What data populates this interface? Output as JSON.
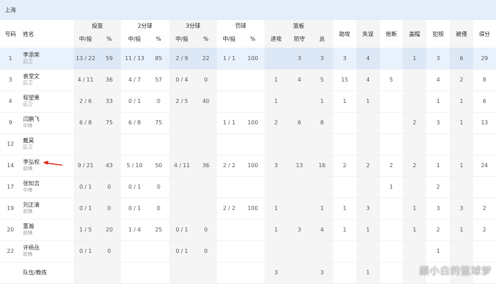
{
  "team": "上海",
  "headers": {
    "number": "号码",
    "name": "姓名",
    "fg": "投篮",
    "two": "2分球",
    "three": "3分球",
    "ft": "罚球",
    "reb": "篮板",
    "made_att": "中/投",
    "pct": "%",
    "oreb": "进攻",
    "dreb": "防守",
    "treb": "总",
    "ast": "助攻",
    "tov": "失误",
    "stl": "抢断",
    "blk": "盖帽",
    "pf": "犯规",
    "fd": "被侵",
    "pts": "得分"
  },
  "rows": [
    {
      "no": "1",
      "name": "李添荣",
      "pos": "后卫",
      "fg": "13 / 22",
      "fgp": "59",
      "two": "11 / 13",
      "twop": "85",
      "three": "2 / 9",
      "threep": "22",
      "ft": "1 / 1",
      "ftp": "100",
      "oreb": "",
      "dreb": "3",
      "treb": "3",
      "ast": "3",
      "tov": "4",
      "stl": "",
      "blk": "1",
      "pf": "3",
      "fd": "6",
      "pts": "29"
    },
    {
      "no": "3",
      "name": "袁堂文",
      "pos": "后卫",
      "fg": "4 / 11",
      "fgp": "36",
      "two": "4 / 7",
      "twop": "57",
      "three": "0 / 4",
      "threep": "0",
      "ft": "",
      "ftp": "",
      "oreb": "1",
      "dreb": "4",
      "treb": "5",
      "ast": "15",
      "tov": "4",
      "stl": "5",
      "blk": "",
      "pf": "4",
      "fd": "2",
      "pts": "8"
    },
    {
      "no": "4",
      "name": "程望果",
      "pos": "后卫",
      "fg": "2 / 6",
      "fgp": "33",
      "two": "0 / 1",
      "twop": "0",
      "three": "2 / 5",
      "threep": "40",
      "ft": "",
      "ftp": "",
      "oreb": "1",
      "dreb": "",
      "treb": "1",
      "ast": "1",
      "tov": "1",
      "stl": "",
      "blk": "",
      "pf": "1",
      "fd": "1",
      "pts": "6"
    },
    {
      "no": "9",
      "name": "闫鹏飞",
      "pos": "中锋",
      "fg": "6 / 8",
      "fgp": "75",
      "two": "6 / 8",
      "twop": "75",
      "three": "",
      "threep": "",
      "ft": "1 / 1",
      "ftp": "100",
      "oreb": "2",
      "dreb": "6",
      "treb": "8",
      "ast": "",
      "tov": "",
      "stl": "",
      "blk": "2",
      "pf": "3",
      "fd": "1",
      "pts": "13"
    },
    {
      "no": "12",
      "name": "戴昊",
      "pos": "后卫",
      "fg": "",
      "fgp": "",
      "two": "",
      "twop": "",
      "three": "",
      "threep": "",
      "ft": "",
      "ftp": "",
      "oreb": "",
      "dreb": "",
      "treb": "",
      "ast": "",
      "tov": "",
      "stl": "",
      "blk": "",
      "pf": "",
      "fd": "",
      "pts": ""
    },
    {
      "no": "14",
      "name": "李弘权",
      "pos": "前锋",
      "fg": "9 / 21",
      "fgp": "43",
      "two": "5 / 10",
      "twop": "50",
      "three": "4 / 11",
      "threep": "36",
      "ft": "2 / 2",
      "ftp": "100",
      "oreb": "3",
      "dreb": "13",
      "treb": "16",
      "ast": "2",
      "tov": "2",
      "stl": "2",
      "blk": "2",
      "pf": "1",
      "fd": "1",
      "pts": "24"
    },
    {
      "no": "17",
      "name": "张知吉",
      "pos": "中锋",
      "fg": "0 / 1",
      "fgp": "0",
      "two": "0 / 1",
      "twop": "0",
      "three": "",
      "threep": "",
      "ft": "",
      "ftp": "",
      "oreb": "",
      "dreb": "",
      "treb": "",
      "ast": "",
      "tov": "",
      "stl": "1",
      "blk": "",
      "pf": "2",
      "fd": "",
      "pts": ""
    },
    {
      "no": "19",
      "name": "刘正清",
      "pos": "前锋",
      "fg": "0 / 1",
      "fgp": "0",
      "two": "0 / 1",
      "twop": "0",
      "three": "",
      "threep": "",
      "ft": "2 / 2",
      "ftp": "100",
      "oreb": "1",
      "dreb": "",
      "treb": "1",
      "ast": "1",
      "tov": "3",
      "stl": "",
      "blk": "1",
      "pf": "3",
      "fd": "3",
      "pts": "2"
    },
    {
      "no": "20",
      "name": "董瀚",
      "pos": "前锋",
      "fg": "1 / 5",
      "fgp": "20",
      "two": "1 / 4",
      "twop": "25",
      "three": "0 / 1",
      "threep": "0",
      "ft": "",
      "ftp": "",
      "oreb": "1",
      "dreb": "3",
      "treb": "4",
      "ast": "1",
      "tov": "1",
      "stl": "",
      "blk": "1",
      "pf": "2",
      "fd": "1",
      "pts": "2"
    },
    {
      "no": "22",
      "name": "许杨岳",
      "pos": "前锋",
      "fg": "0 / 1",
      "fgp": "0",
      "two": "",
      "twop": "",
      "three": "0 / 1",
      "threep": "0",
      "ft": "",
      "ftp": "",
      "oreb": "",
      "dreb": "",
      "treb": "",
      "ast": "",
      "tov": "",
      "stl": "",
      "blk": "",
      "pf": "1",
      "fd": "",
      "pts": ""
    },
    {
      "no": "",
      "name": "队伍/教练",
      "pos": "",
      "fg": "",
      "fgp": "",
      "two": "",
      "twop": "",
      "three": "",
      "threep": "",
      "ft": "",
      "ftp": "",
      "oreb": "3",
      "dreb": "",
      "treb": "3",
      "ast": "",
      "tov": "1",
      "stl": "",
      "blk": "",
      "pf": "",
      "fd": "",
      "pts": ""
    }
  ],
  "highlight_row": 0,
  "arrow_row": 5,
  "colors": {
    "header_bg": "#e3eefa",
    "highlight": "#e8f1fc",
    "shade": "#f5f5f5",
    "arrow": "#e0281e"
  },
  "watermark": "颜小白的篮球梦"
}
